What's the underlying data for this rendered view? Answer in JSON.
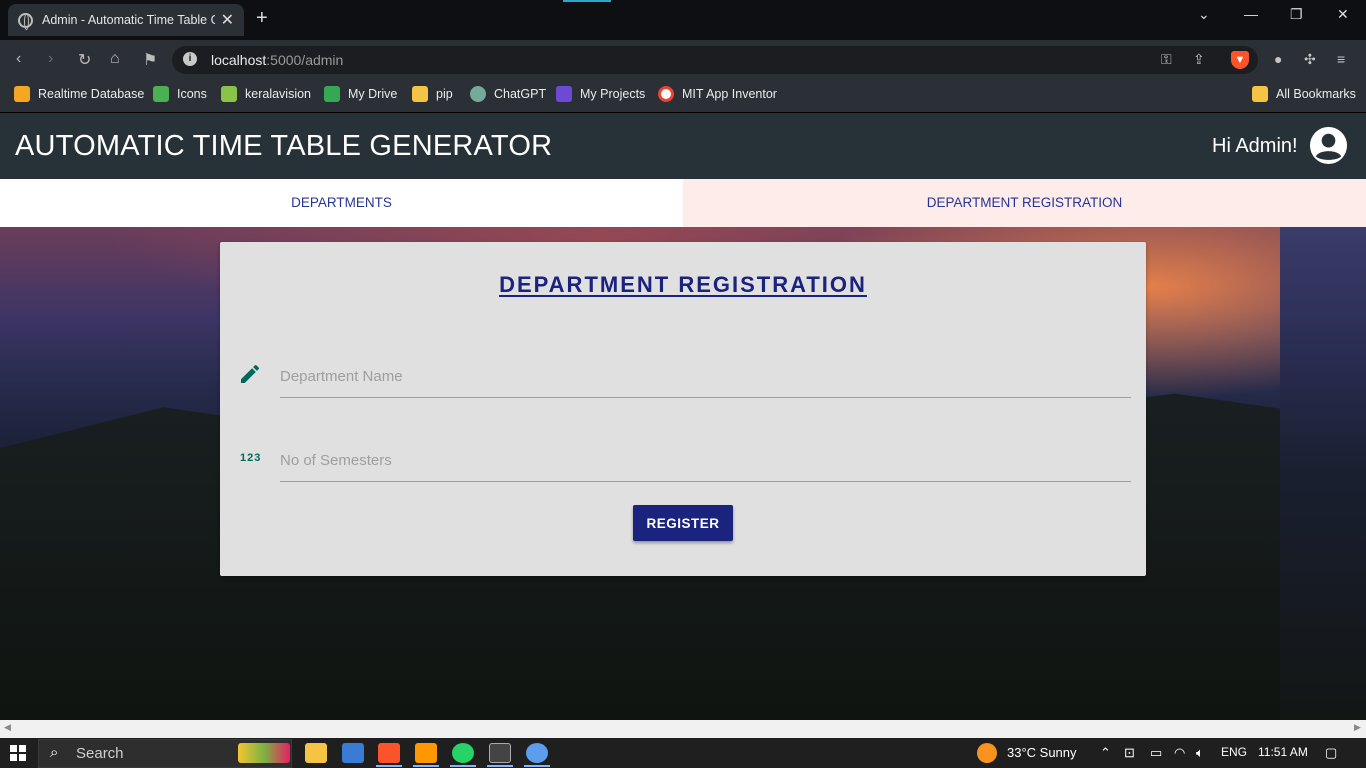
{
  "browser": {
    "tab_title": "Admin - Automatic Time Table G",
    "url_host": "localhost",
    "url_path": ":5000/admin",
    "bookmarks": [
      {
        "label": "Realtime Database",
        "icon": "firebase-icon",
        "color": "#f5a623"
      },
      {
        "label": "Icons",
        "icon": "icons-site-icon",
        "color": "#4caf50"
      },
      {
        "label": "keralavision",
        "icon": "keralavision-icon",
        "color": "#8bc34a"
      },
      {
        "label": "My Drive",
        "icon": "google-drive-icon",
        "color": "#34a853"
      },
      {
        "label": "pip",
        "icon": "folder-icon",
        "color": "#f6c445"
      },
      {
        "label": "ChatGPT",
        "icon": "chatgpt-icon",
        "color": "#74aa9c"
      },
      {
        "label": "My Projects",
        "icon": "projects-icon",
        "color": "#6c4ad6"
      },
      {
        "label": "MIT App Inventor",
        "icon": "google-icon",
        "color": "#ea4335"
      }
    ],
    "all_bookmarks": "All Bookmarks"
  },
  "app": {
    "title": "AUTOMATIC TIME TABLE GENERATOR",
    "greeting": "Hi Admin!",
    "tabs": [
      {
        "label": "DEPARTMENTS"
      },
      {
        "label": "DEPARTMENT REGISTRATION"
      }
    ]
  },
  "form": {
    "heading": "DEPARTMENT REGISTRATION",
    "department_name_placeholder": "Department Name",
    "semesters_placeholder": "No of Semesters",
    "semesters_icon_text": "123",
    "register_label": "REGISTER"
  },
  "taskbar": {
    "search_label": "Search",
    "weather": "33°C  Sunny",
    "language": "ENG",
    "time": "11:51 AM"
  },
  "colors": {
    "app_bar": "#263238",
    "accent": "#1a237e",
    "icon_teal": "#00695c"
  }
}
